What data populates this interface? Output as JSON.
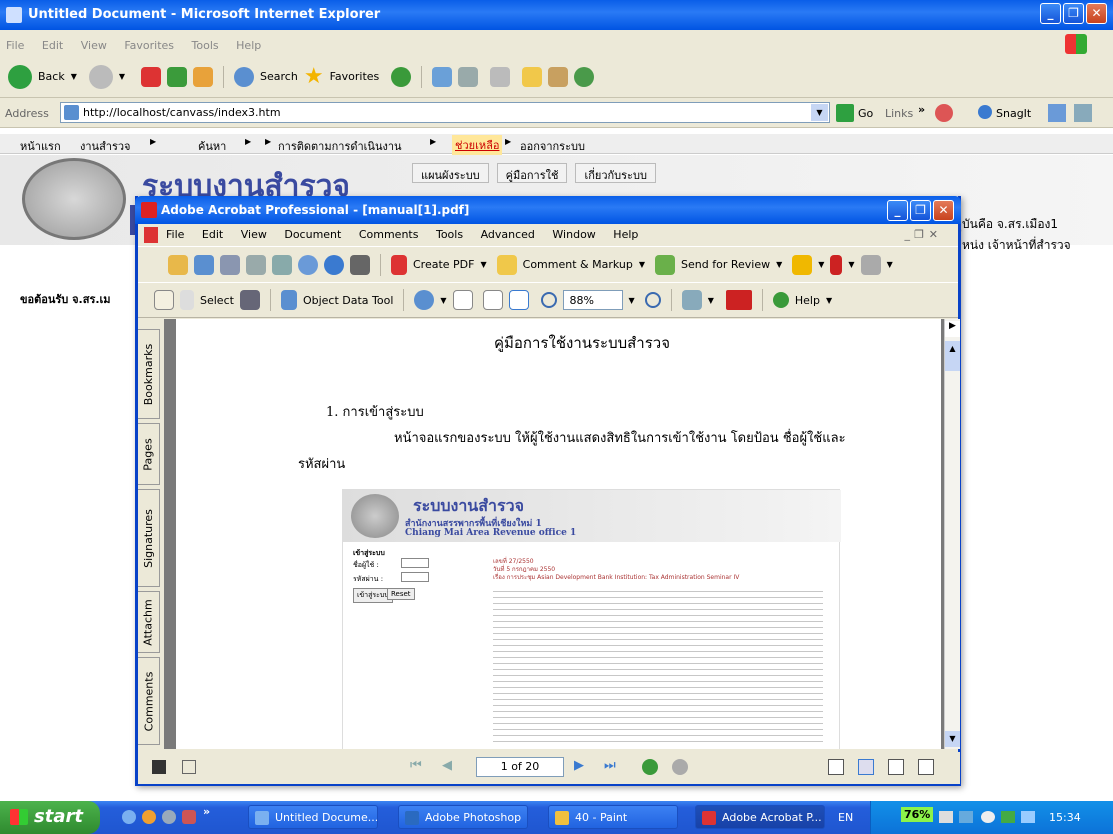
{
  "ie": {
    "title": "Untitled Document - Microsoft Internet Explorer",
    "menu": [
      "File",
      "Edit",
      "View",
      "Favorites",
      "Tools",
      "Help"
    ],
    "toolbar": {
      "back": "Back",
      "search": "Search",
      "favorites": "Favorites"
    },
    "address_label": "Address",
    "address_value": "http://localhost/canvass/index3.htm",
    "go": "Go",
    "links": "Links",
    "snagit": "SnagIt"
  },
  "site": {
    "nav": [
      "หน้าแรก",
      "งานสำรวจ",
      "ค้นหา",
      "การติดตามการดำเนินงาน",
      "ช่วยเหลือ",
      "ออกจากระบบ"
    ],
    "submenu": [
      "แผนผังระบบ",
      "คู่มือการใช้",
      "เกี่ยวกับระบบ"
    ],
    "banner_title": "ระบบงานสำรวจ",
    "right_text_1": "จุบันคือ จ.สร.เมือง1",
    "right_text_2": "หน่ง เจ้าหน้าที่สำรวจ",
    "welcome": "ขอต้อนรับ จ.สร.เม"
  },
  "acrobat": {
    "title": "Adobe Acrobat Professional - [manual[1].pdf]",
    "menu": [
      "File",
      "Edit",
      "View",
      "Document",
      "Comments",
      "Tools",
      "Advanced",
      "Window",
      "Help"
    ],
    "toolbar": {
      "create_pdf": "Create PDF",
      "comment_markup": "Comment & Markup",
      "send_review": "Send for Review"
    },
    "toolbar2": {
      "select": "Select",
      "object_data_tool": "Object Data Tool",
      "zoom": "88%",
      "help": "Help"
    },
    "side_tabs": [
      "Bookmarks",
      "Pages",
      "Signatures",
      "Attachm",
      "Comments"
    ],
    "page_indicator": "1 of 20",
    "doc": {
      "heading": "คู่มือการใช้งานระบบสำรวจ",
      "section": "1. การเข้าสู่ระบบ",
      "para_1": "หน้าจอแรกของระบบ ให้ผู้ใช้งานแสดงสิทธิในการเข้าใช้งาน โดยป้อน ชื่อผู้ใช้และ",
      "para_2": "รหัสผ่าน",
      "embedded": {
        "title": "ระบบงานสำรวจ",
        "subtitle": "สำนักงานสรรพากรพื้นที่เชียงใหม่ 1",
        "subtitle_en": "Chiang Mai Area Revenue office 1",
        "login_head": "เข้าสู่ระบบ",
        "user_label": "ชื่อผู้ใช้ :",
        "pass_label": "รหัสผ่าน :",
        "login_btn": "เข้าสู่ระบบ",
        "reset_btn": "Reset",
        "memo_1": "เลขที่ 27/2550",
        "memo_2": "วันที่ 5 กรกฎาคม 2550",
        "memo_3": "เรื่อง การประชุม Asian Development Bank Institution: Tax Administration Seminar IV"
      }
    }
  },
  "taskbar": {
    "start": "start",
    "items": [
      "Untitled Docume...",
      "Adobe Photoshop",
      "40 - Paint",
      "Adobe Acrobat P..."
    ],
    "lang": "EN",
    "battery": "76%",
    "clock": "15:34"
  }
}
